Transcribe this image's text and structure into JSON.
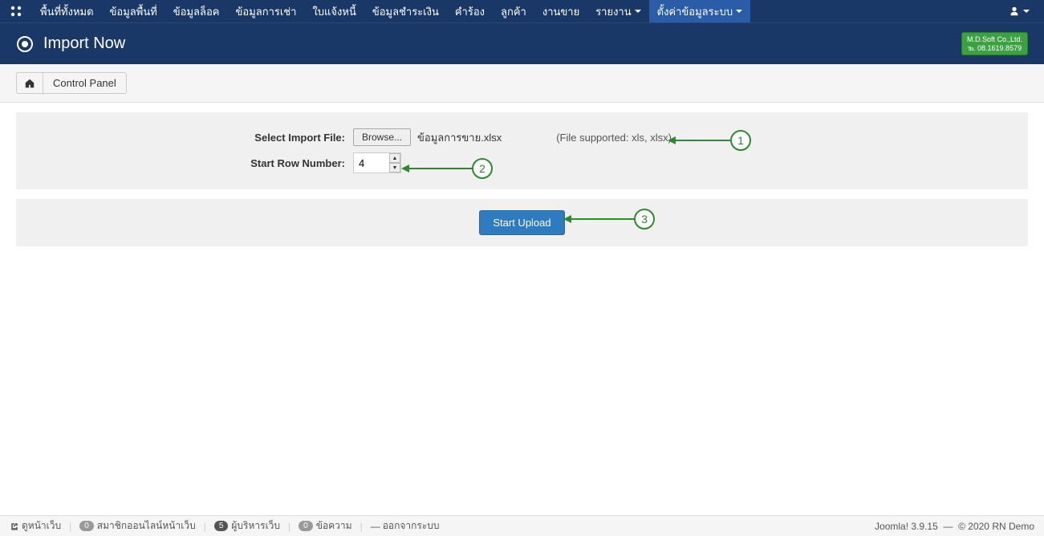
{
  "nav": {
    "items": [
      "พื้นที่ทั้งหมด",
      "ข้อมูลพื้นที่",
      "ข้อมูลล็อค",
      "ข้อมูลการเช่า",
      "ใบแจ้งหนี้",
      "ข้อมูลชำระเงิน",
      "คำร้อง",
      "ลูกค้า",
      "งานขาย",
      "รายงาน",
      "ตั้งค่าข้อมูลระบบ"
    ],
    "active_index": 10
  },
  "header": {
    "title": "Import Now",
    "badge_line1": "M.D.Soft Co.,Ltd.",
    "badge_line2": "℡ 08.1619.8579"
  },
  "toolbar": {
    "control_panel": "Control Panel"
  },
  "form": {
    "select_file_label": "Select Import File:",
    "browse_label": "Browse...",
    "filename": "ข้อมูลการขาย.xlsx",
    "file_hint": "(File supported: xls, xlsx)",
    "start_row_label": "Start Row Number:",
    "start_row_value": "4",
    "upload_label": "Start Upload"
  },
  "annotations": {
    "n1": "1",
    "n2": "2",
    "n3": "3"
  },
  "footer": {
    "view_site": "ดูหน้าเว็บ",
    "visitors_count": "0",
    "visitors_label": "สมาชิกออนไลน์หน้าเว็บ",
    "admins_count": "5",
    "admins_label": "ผู้บริหารเว็บ",
    "messages_count": "0",
    "messages_label": "ข้อความ",
    "logout": "ออกจากระบบ",
    "version": "Joomla! 3.9.15",
    "copyright": "© 2020 RN Demo"
  }
}
